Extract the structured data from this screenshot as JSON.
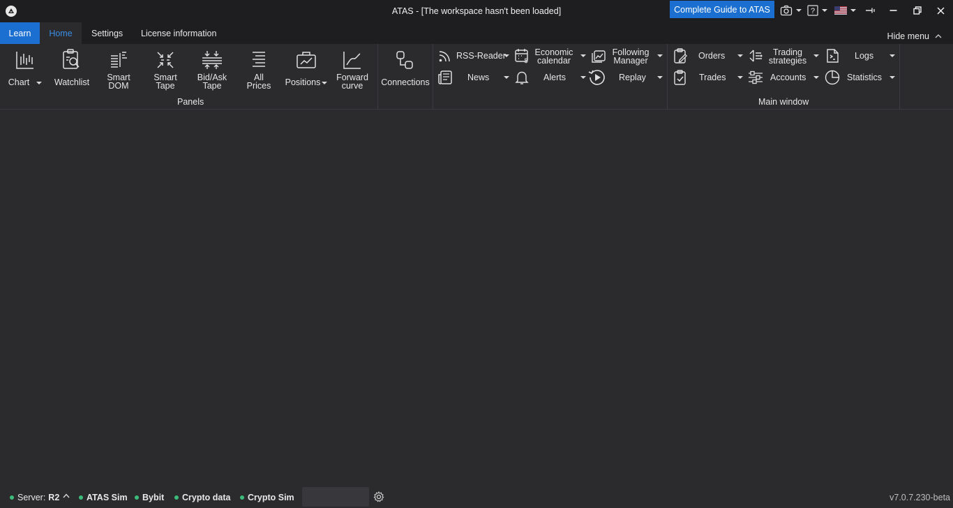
{
  "window": {
    "title": "ATAS - [The workspace hasn't been loaded]",
    "guide_button": "Complete Guide to ATAS"
  },
  "tabs": {
    "learn": "Learn",
    "home": "Home",
    "settings": "Settings",
    "license": "License information",
    "hide_menu": "Hide menu"
  },
  "panels": {
    "chart": "Chart",
    "watchlist": "Watchlist",
    "smart_dom": "Smart DOM",
    "smart_tape": "Smart Tape",
    "bid_ask_tape": "Bid/Ask Tape",
    "all_prices": "All Prices",
    "positions": "Positions",
    "forward_curve": "Forward curve",
    "group_label": "Panels"
  },
  "connections": "Connections",
  "tools": {
    "rss_reader": "RSS-Reader",
    "news": "News",
    "economic_calendar": "Economic calendar",
    "alerts": "Alerts",
    "following_manager": "Following Manager",
    "replay": "Replay"
  },
  "main_window": {
    "orders": "Orders",
    "trades": "Trades",
    "trading_strategies": "Trading strategies",
    "accounts": "Accounts",
    "logs": "Logs",
    "statistics": "Statistics",
    "group_label": "Main window"
  },
  "status": {
    "server_label": "Server:",
    "server_value": "R2",
    "connections": [
      "ATAS Sim",
      "Bybit",
      "Crypto data",
      "Crypto Sim"
    ],
    "version": "v7.0.7.230-beta"
  },
  "colors": {
    "accent": "#1a6fd0",
    "home_tab_text": "#3b8de6",
    "status_dot": "#3dbb7a",
    "background": "#2b2b2e",
    "titlebar": "#1e1e20"
  }
}
